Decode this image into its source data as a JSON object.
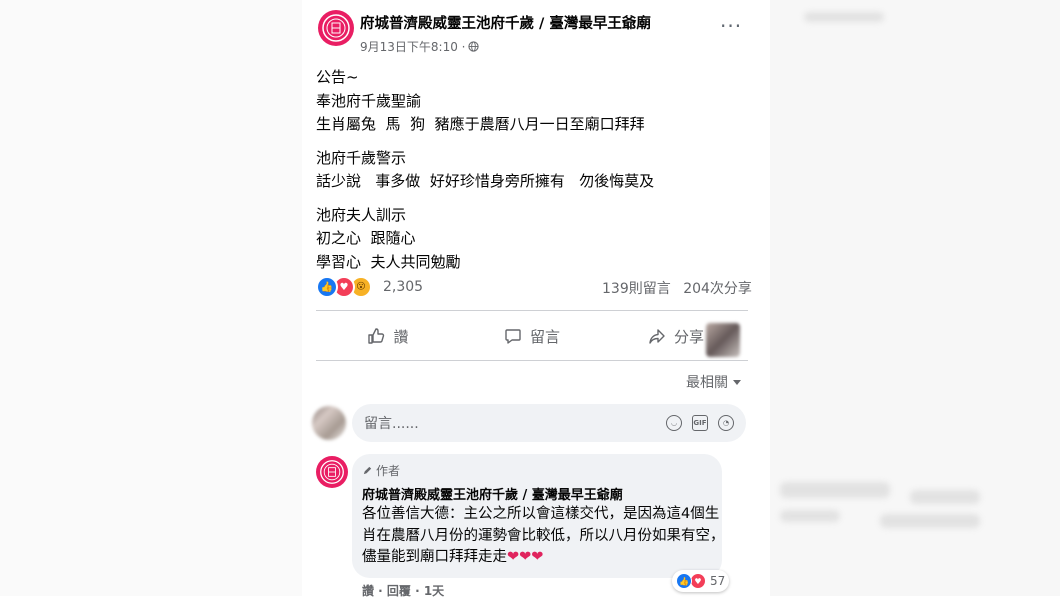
{
  "post": {
    "page_name": "府城普濟殿威靈王池府千歲 / 臺灣最早王爺廟",
    "time": "9月13日下午8:10 ·",
    "more_label": "···",
    "body": [
      [
        "公告~",
        "奉池府千歲聖諭",
        "生肖屬兔  馬  狗  豬應于農曆八月一日至廟口拜拜"
      ],
      [
        "池府千歲警示",
        "話少說   事多做  好好珍惜身旁所擁有   勿後悔莫及"
      ],
      [
        "池府夫人訓示",
        "初之心  跟隨心",
        "學習心  夫人共同勉勵"
      ]
    ],
    "reaction_count": "2,305",
    "comment_count": "139則留言",
    "share_count": "204次分享"
  },
  "actions": {
    "like": "讚",
    "comment": "留言",
    "share": "分享"
  },
  "sort_label": "最相關",
  "comment_input": {
    "placeholder": "留言......"
  },
  "comment": {
    "author_badge": "作者",
    "author_name": "府城普濟殿威靈王池府千歲 / 臺灣最早王爺廟",
    "lines": [
      "各位善信大德：主公之所以會這樣交代，是因為這4個生",
      "肖在農曆八月份的運勢會比較低，所以八月份如果有空，",
      "儘量能到廟口拜拜走走"
    ],
    "hearts": "❤❤❤",
    "reaction_count": "57",
    "footer": "讚 · 回覆 · 1天"
  },
  "colors": {
    "brand_pink": "#e91e63",
    "like_blue": "#1877f2",
    "love_red": "#f33e58",
    "wow_yellow": "#f7b125",
    "muted_text": "#65676b",
    "bubble_bg": "#f0f2f5"
  },
  "icons": [
    "globe-icon",
    "more-icon",
    "like-icon",
    "comment-icon",
    "share-icon",
    "chevron-down-icon",
    "emoji-icon",
    "gif-icon",
    "sticker-icon",
    "pencil-icon",
    "heart-icon"
  ]
}
